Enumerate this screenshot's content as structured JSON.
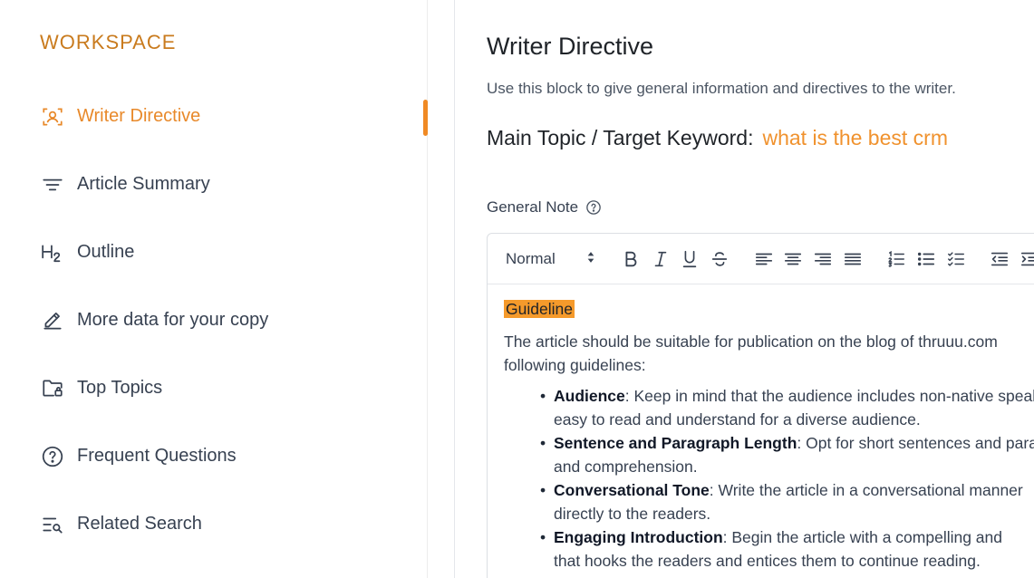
{
  "sidebar": {
    "title": "WORKSPACE",
    "items": [
      {
        "label": "Writer Directive",
        "icon": "user-focus-icon",
        "active": true
      },
      {
        "label": "Article Summary",
        "icon": "filter-lines-icon"
      },
      {
        "label": "Outline",
        "icon": "heading-h2-icon"
      },
      {
        "label": "More data for your copy",
        "icon": "pencil-icon"
      },
      {
        "label": "Top Topics",
        "icon": "folder-lock-icon"
      },
      {
        "label": "Frequent Questions",
        "icon": "question-circle-icon"
      },
      {
        "label": "Related Search",
        "icon": "list-search-icon"
      }
    ]
  },
  "main": {
    "title": "Writer Directive",
    "description": "Use this block to give general information and directives to the writer.",
    "topic_label": "Main Topic / Target Keyword:",
    "topic_value": "what is the best crm",
    "note_label": "General Note",
    "editor": {
      "format_value": "Normal",
      "heading": "Guideline",
      "intro_line1": "The article should be suitable for publication on the blog of thruuu.com",
      "intro_line2": "following guidelines:",
      "bullets": [
        {
          "bold": "Audience",
          "text": ": Keep in mind that the audience includes non-native speakers",
          "cont": "easy to read and understand for a diverse audience."
        },
        {
          "bold": "Sentence and Paragraph Length",
          "text": ": Opt for short sentences and paragraphs",
          "cont": "and comprehension."
        },
        {
          "bold": "Conversational Tone",
          "text": ": Write the article in a conversational manner",
          "cont": "directly to the readers."
        },
        {
          "bold": "Engaging Introduction",
          "text": ": Begin the article with a compelling and",
          "cont": "that hooks the readers and entices them to continue reading."
        }
      ]
    }
  },
  "colors": {
    "accent": "#f08a24",
    "workspace_title": "#c97b1e",
    "highlight": "#f59a2b"
  }
}
